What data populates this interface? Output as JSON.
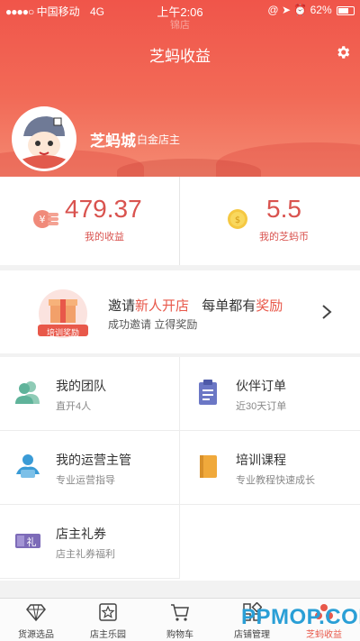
{
  "status_bar": {
    "carrier": "中国移动",
    "network": "4G",
    "time": "上午2:06",
    "battery": "62%",
    "faded_text": "锦店"
  },
  "header": {
    "title": "芝蚂收益",
    "user_name": "芝蚂城",
    "user_level": "白金店主",
    "settings_icon": "gear-icon"
  },
  "stats": {
    "income_value": "479.37",
    "income_label": "我的收益",
    "coin_value": "5.5",
    "coin_label": "我的芝蚂币"
  },
  "invite": {
    "badge_label": "培训奖励",
    "title_prefix": "邀请",
    "title_highlight1": "新人开店",
    "title_middle": "每单都有",
    "title_highlight2": "奖励",
    "subtitle": "成功邀请  立得奖励"
  },
  "grid": [
    {
      "title": "我的团队",
      "desc": "直开4人",
      "icon": "team-icon"
    },
    {
      "title": "伙伴订单",
      "desc": "近30天订单",
      "icon": "clipboard-icon"
    },
    {
      "title": "我的运营主管",
      "desc": "专业运营指导",
      "icon": "manager-icon"
    },
    {
      "title": "培训课程",
      "desc": "专业教程快速成长",
      "icon": "book-icon"
    },
    {
      "title": "店主礼券",
      "desc": "店主礼券福利",
      "icon": "coupon-icon"
    }
  ],
  "coupon_glyph": "礼",
  "tabs": [
    {
      "label": "货源选品",
      "icon": "diamond-icon"
    },
    {
      "label": "店主乐园",
      "icon": "star-icon"
    },
    {
      "label": "购物车",
      "icon": "cart-icon"
    },
    {
      "label": "店铺管理",
      "icon": "grid-icon"
    },
    {
      "label": "芝蚂收益",
      "icon": "income-icon",
      "active": true
    }
  ],
  "watermark": "PPMOP.COM",
  "colors": {
    "header": "#f0554a",
    "accent_red": "#d9534f",
    "team_icon": "#5fb39a",
    "clipboard_icon": "#6b77c5",
    "manager_icon": "#3a9bd6",
    "book_icon": "#f0a93b",
    "coupon_icon": "#7d6bb8"
  }
}
